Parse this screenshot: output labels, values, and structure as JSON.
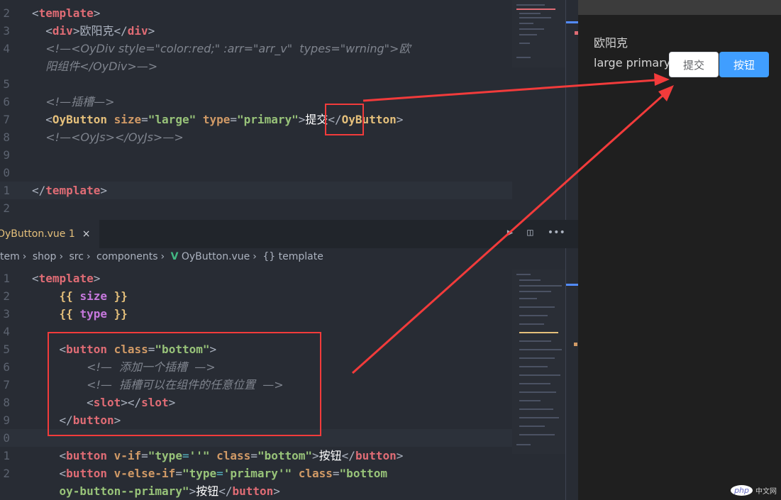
{
  "top_editor": {
    "lines": [
      {
        "num": "2",
        "html": "<span class='punc'>&lt;</span><span class='tag'>template</span><span class='punc'>&gt;</span>"
      },
      {
        "num": "3",
        "html": "  <span class='punc'>&lt;</span><span class='tag'>div</span><span class='punc'>&gt;</span><span class='txt'>欧阳克</span><span class='punc'>&lt;/</span><span class='tag'>div</span><span class='punc'>&gt;</span>"
      },
      {
        "num": "4",
        "html": "  <span class='cmt'>&lt;!—&lt;OyDiv style=\"color:red;\" :arr=\"arr_v\"  types=\"wrning\"&gt;欧</span>"
      },
      {
        "num": "",
        "html": "  <span class='cmt'>阳组件&lt;/OyDiv&gt;—&gt;</span>"
      },
      {
        "num": "5",
        "html": ""
      },
      {
        "num": "6",
        "html": "  <span class='cmt'>&lt;!—插槽—&gt;</span>"
      },
      {
        "num": "7",
        "html": "  <span class='punc'>&lt;</span><span class='tag' style='color:#e5c07b'>OyButton</span> <span class='attr'>size</span><span class='punc'>=</span><span class='str'>\"large\"</span> <span class='attr'>type</span><span class='punc'>=</span><span class='str'>\"primary\"</span><span class='punc'>&gt;</span><span class='txt' style='color:#ffffff'>提交</span><span class='punc'>&lt;/</span><span class='tag' style='color:#e5c07b'>OyButton</span><span class='punc'>&gt;</span>"
      },
      {
        "num": "8",
        "html": "  <span class='cmt'>&lt;!—&lt;OyJs&gt;&lt;/OyJs&gt;—&gt;</span>"
      },
      {
        "num": "9",
        "html": ""
      },
      {
        "num": "0",
        "html": ""
      },
      {
        "num": "1",
        "html": "<span class='punc'>&lt;/</span><span class='tag'>template</span><span class='punc'>&gt;</span>"
      },
      {
        "num": "2",
        "html": ""
      }
    ]
  },
  "bottom_editor": {
    "tab_label": "OyButton.vue 1",
    "close_icon": "×",
    "breadcrumb": [
      "tem",
      "shop",
      "src",
      "components",
      "OyButton.vue",
      "template"
    ],
    "lines": [
      {
        "num": "1",
        "html": "<span class='punc'>&lt;</span><span class='tag'>template</span><span class='punc'>&gt;</span>"
      },
      {
        "num": "2",
        "html": "    <span class='mus'>{{</span> <span class='var'>size</span> <span class='mus'>}}</span>"
      },
      {
        "num": "3",
        "html": "    <span class='mus'>{{</span> <span class='var'>type</span> <span class='mus'>}}</span>"
      },
      {
        "num": "4",
        "html": ""
      },
      {
        "num": "5",
        "html": "    <span class='punc'>&lt;</span><span class='tag'>button</span> <span class='attr'>class</span><span class='punc'>=</span><span class='str'>\"bottom\"</span><span class='punc'>&gt;</span>"
      },
      {
        "num": "6",
        "html": "        <span class='cmt'>&lt;!—  添加一个插槽  —&gt;</span>"
      },
      {
        "num": "7",
        "html": "        <span class='cmt'>&lt;!—  插槽可以在组件的任意位置  —&gt;</span>"
      },
      {
        "num": "8",
        "html": "        <span class='punc'>&lt;</span><span class='tag'>slot</span><span class='punc'>&gt;&lt;/</span><span class='tag'>slot</span><span class='punc'>&gt;</span>"
      },
      {
        "num": "9",
        "html": "    <span class='punc'>&lt;/</span><span class='tag'>button</span><span class='punc'>&gt;</span>"
      },
      {
        "num": "0",
        "html": ""
      },
      {
        "num": "1",
        "html": "    <span class='punc'>&lt;</span><span class='tag'>button</span> <span class='attr'>v-if</span><span class='punc'>=</span><span class='str'>\"type</span><span class='punc' style='color:#56b6c2'>=</span><span class='str'>''\"</span> <span class='attr'>class</span><span class='punc'>=</span><span class='str'>\"bottom\"</span><span class='punc'>&gt;</span><span class='txt' style='color:#ffffff'>按钮</span><span class='punc'>&lt;/</span><span class='tag'>button</span><span class='punc'>&gt;</span>"
      },
      {
        "num": "2",
        "html": "    <span class='punc'>&lt;</span><span class='tag'>button</span> <span class='attr'>v-else-if</span><span class='punc'>=</span><span class='str'>\"type</span><span class='punc' style='color:#56b6c2'>=</span><span class='str'>'primary'\"</span> <span class='attr'>class</span><span class='punc'>=</span><span class='str'>\"bottom</span>"
      },
      {
        "num": "",
        "html": "    <span class='str'>oy-button--primary\"</span><span class='punc'>&gt;</span><span class='txt' style='color:#ffffff'>按钮</span><span class='punc'>&lt;/</span><span class='tag'>button</span><span class='punc'>&gt;</span>"
      }
    ]
  },
  "preview": {
    "name_text": "欧阳克",
    "props_text": "large primary",
    "submit_label": "提交",
    "primary_label": "按钮"
  },
  "watermark": {
    "logo": "php",
    "text": "中文网"
  },
  "colors": {
    "annotation_red": "#f23b3b",
    "primary_button": "#409eff"
  }
}
